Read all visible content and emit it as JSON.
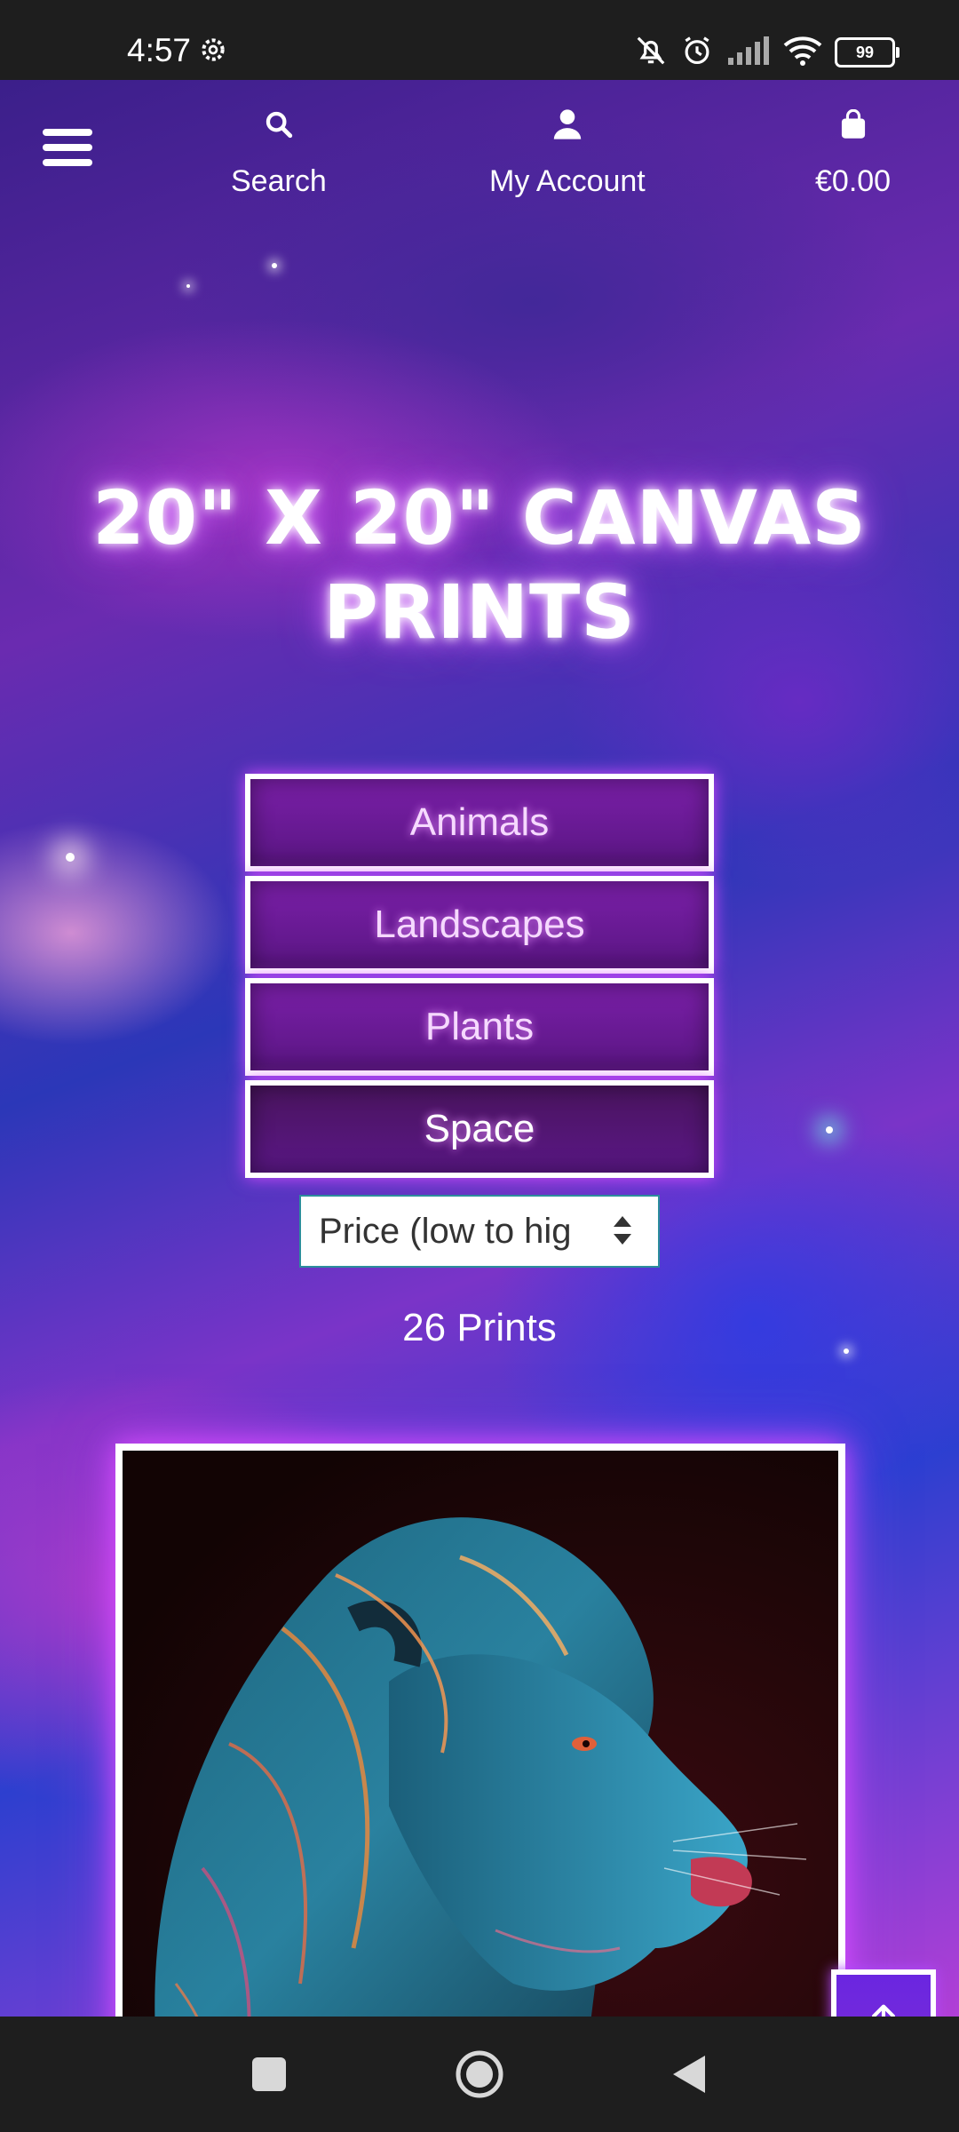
{
  "status_bar": {
    "time": "4:57",
    "battery": "99",
    "icons": [
      "settings-icon",
      "bell-off-icon",
      "alarm-icon",
      "signal-icon",
      "wifi-icon",
      "battery-icon"
    ]
  },
  "header": {
    "menu_icon": "hamburger-icon",
    "search_label": "Search",
    "account_label": "My Account",
    "cart_total": "€0.00"
  },
  "page": {
    "title": "20\" X 20\" CANVAS PRINTS",
    "categories": [
      {
        "label": "Animals"
      },
      {
        "label": "Landscapes"
      },
      {
        "label": "Plants"
      },
      {
        "label": "Space"
      }
    ],
    "sort": {
      "value": "Price (low to hig"
    },
    "count_text": "26 Prints"
  },
  "colors": {
    "accent_glow": "#d64dff",
    "category_bg": "#6a1a96",
    "back_to_top_bg": "#6a26e0"
  },
  "product": {
    "image_icon": "lion-artwork-image"
  },
  "back_to_top_icon": "arrow-up-icon",
  "system_nav": {
    "icons": [
      "recents-square-icon",
      "home-circle-icon",
      "back-triangle-icon"
    ]
  }
}
